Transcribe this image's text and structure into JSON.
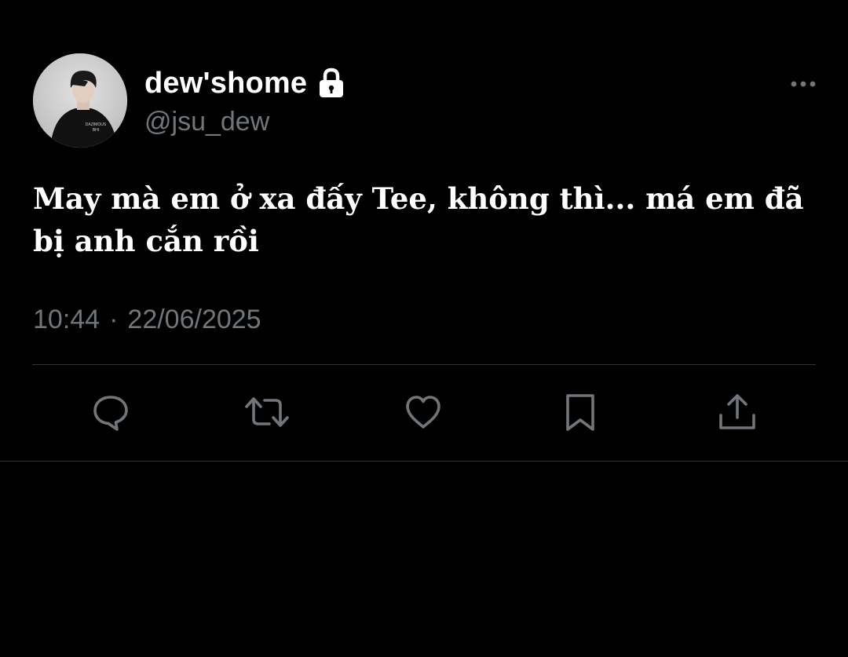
{
  "author": {
    "display_name": "dew'shome",
    "handle": "@jsu_dew",
    "protected_icon": "lock-icon",
    "avatar_shirt_text": [
      "DAZIMOUS",
      "BHI"
    ]
  },
  "tweet": {
    "text": "May mà em ở xa đấy Tee, không thì... má em đã bị anh cắn rồi",
    "time": "10:44",
    "separator": "·",
    "date": "22/06/2025"
  },
  "actions": [
    {
      "name": "reply",
      "icon": "comment-icon"
    },
    {
      "name": "retweet",
      "icon": "retweet-icon"
    },
    {
      "name": "like",
      "icon": "heart-icon"
    },
    {
      "name": "bookmark",
      "icon": "bookmark-icon"
    },
    {
      "name": "share",
      "icon": "share-icon"
    }
  ],
  "colors": {
    "background": "#000000",
    "primary_text": "#ffffff",
    "secondary_text": "#71767b",
    "icon": "#71767b",
    "divider": "#2f3336"
  }
}
